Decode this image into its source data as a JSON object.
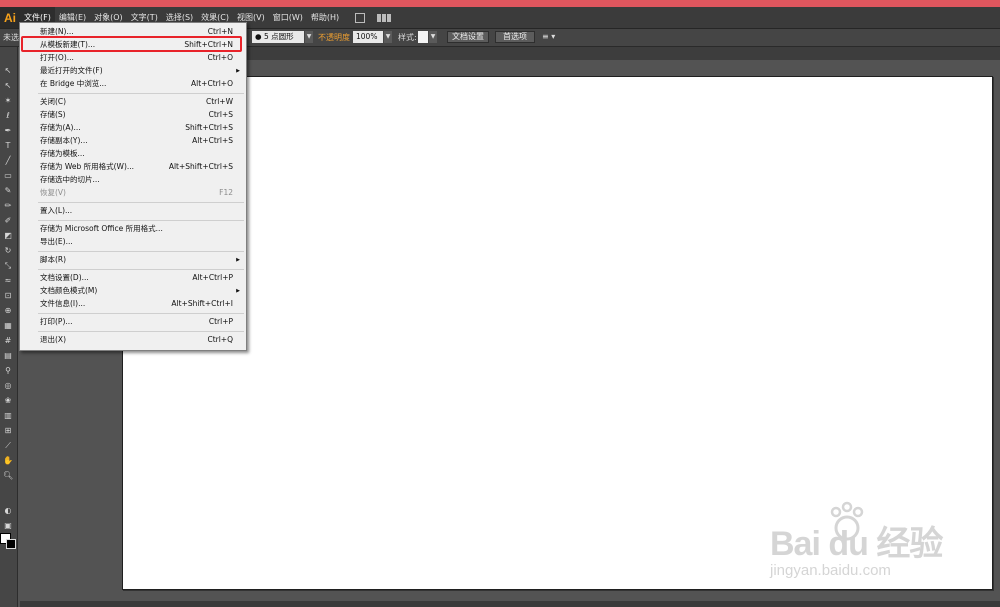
{
  "app": {
    "logo": "Ai"
  },
  "menubar": {
    "items": [
      "文件(F)",
      "编辑(E)",
      "对象(O)",
      "文字(T)",
      "选择(S)",
      "效果(C)",
      "视图(V)",
      "窗口(W)",
      "帮助(H)"
    ]
  },
  "controlbar": {
    "selection_label": "未选",
    "stroke_profile": "5 点圆形",
    "opacity_label": "不透明度",
    "opacity_value": "100%",
    "style_label": "样式:",
    "doc_setup_button": "文档设置",
    "preferences_button": "首选项"
  },
  "file_menu": {
    "items": [
      {
        "label": "新建(N)...",
        "shortcut": "Ctrl+N"
      },
      {
        "label": "从模板新建(T)...",
        "shortcut": "Shift+Ctrl+N"
      },
      {
        "label": "打开(O)...",
        "shortcut": "Ctrl+O"
      },
      {
        "label": "最近打开的文件(F)",
        "shortcut": ""
      },
      {
        "label": "在 Bridge 中浏览...",
        "shortcut": "Alt+Ctrl+O"
      },
      {
        "label": "关闭(C)",
        "shortcut": "Ctrl+W"
      },
      {
        "label": "存储(S)",
        "shortcut": "Ctrl+S"
      },
      {
        "label": "存储为(A)...",
        "shortcut": "Shift+Ctrl+S"
      },
      {
        "label": "存储副本(Y)...",
        "shortcut": "Alt+Ctrl+S"
      },
      {
        "label": "存储为模板...",
        "shortcut": ""
      },
      {
        "label": "存储为 Web 所用格式(W)...",
        "shortcut": "Alt+Shift+Ctrl+S"
      },
      {
        "label": "存储选中的切片...",
        "shortcut": ""
      },
      {
        "label": "恢复(V)",
        "shortcut": "F12"
      },
      {
        "label": "置入(L)...",
        "shortcut": ""
      },
      {
        "label": "存储为 Microsoft Office 所用格式...",
        "shortcut": ""
      },
      {
        "label": "导出(E)...",
        "shortcut": ""
      },
      {
        "label": "脚本(R)",
        "shortcut": ""
      },
      {
        "label": "文档设置(D)...",
        "shortcut": "Alt+Ctrl+P"
      },
      {
        "label": "文档颜色模式(M)",
        "shortcut": ""
      },
      {
        "label": "文件信息(I)...",
        "shortcut": "Alt+Shift+Ctrl+I"
      },
      {
        "label": "打印(P)...",
        "shortcut": "Ctrl+P"
      },
      {
        "label": "退出(X)",
        "shortcut": "Ctrl+Q"
      }
    ]
  },
  "watermark": {
    "logo": "Bai du 经验",
    "site": "jingyan.baidu.com"
  }
}
